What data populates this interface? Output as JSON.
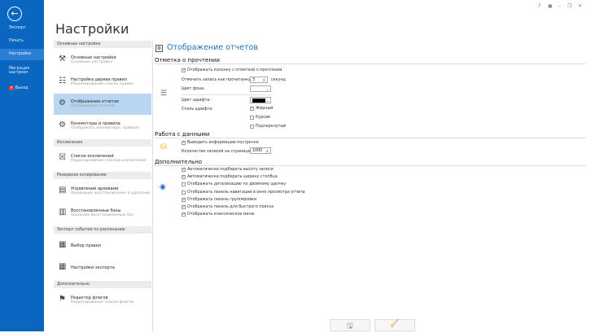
{
  "window": {
    "controls": [
      "?",
      "▣",
      "–",
      "❐",
      "✕"
    ]
  },
  "sidebar": {
    "items": [
      {
        "label": "Экспорт"
      },
      {
        "label": "Печать"
      },
      {
        "label": "Настройки"
      },
      {
        "label": "Миграция настроек"
      },
      {
        "label": "Выход"
      }
    ]
  },
  "page_title": "Настройки",
  "nav": {
    "groups": [
      {
        "header": "Основные настройки",
        "items": [
          {
            "title": "Основные настройки",
            "subtitle": "Основные настройки",
            "icon": "tools-icon"
          },
          {
            "title": "Настройка дерева правил",
            "subtitle": "Редактирование списка правил",
            "icon": "tree-icon"
          },
          {
            "title": "Отображение отчетов",
            "subtitle": "Отображение отчетов",
            "icon": "report-display-icon",
            "selected": true
          },
          {
            "title": "Коннекторы и правила",
            "subtitle": "Отображать коннекторы, правила",
            "icon": "gears-icon"
          }
        ]
      },
      {
        "header": "Исключения",
        "items": [
          {
            "title": "Список исключений",
            "subtitle": "Редактирование списков исключений",
            "icon": "exceptions-icon"
          }
        ]
      },
      {
        "header": "Резервное копирование",
        "items": [
          {
            "title": "Управление архивами",
            "subtitle": "Архивация, восстановление и удаление",
            "icon": "archive-icon"
          },
          {
            "title": "Восстановленные базы",
            "subtitle": "Удаление восстановленных баз",
            "icon": "restored-db-icon"
          }
        ]
      },
      {
        "header": "Экспорт событий по расписанию",
        "items": [
          {
            "title": "Выбор правил",
            "subtitle": "",
            "icon": "rules-icon"
          },
          {
            "title": "Настройки экспорта",
            "subtitle": "",
            "icon": "export-icon"
          }
        ]
      },
      {
        "header": "Дополнительно",
        "items": [
          {
            "title": "Редактор флагов",
            "subtitle": "Редактирование списка флагов",
            "icon": "flag-icon"
          }
        ]
      }
    ]
  },
  "content": {
    "title": "Отображение отчетов",
    "read": {
      "header": "Отметка о прочтении",
      "show_column": "Отображать колонку с отметкой о прочтении",
      "mark_label": "Отмечать запись как прочитанную:",
      "mark_value": "3",
      "mark_unit": "секунд",
      "bg_label": "Цвет фона:",
      "bg_color": "#ffffff",
      "font_label": "Цвет шрифта:",
      "font_color": "#000000",
      "style_label": "Стиль шрифта:",
      "styles": [
        {
          "label": "Жирный",
          "checked": true
        },
        {
          "label": "Курсив",
          "checked": false
        },
        {
          "label": "Подчеркнутый",
          "checked": false
        }
      ]
    },
    "data": {
      "header": "Работа с данными",
      "show_info": "Выводить информацию построчно",
      "count_label": "Количество записей на странице:",
      "count_value": "1000"
    },
    "extra": {
      "header": "Дополнительно",
      "options": [
        {
          "label": "Автоматически подбирать высоту записи",
          "checked": true
        },
        {
          "label": "Автоматически подбирать ширину столбца",
          "checked": true
        },
        {
          "label": "Отображать детализацию по двойному щелчку",
          "checked": false
        },
        {
          "label": "Отображать панель навигации в окне просмотра отчета",
          "checked": false
        },
        {
          "label": "Отображать панель группировки",
          "checked": true
        },
        {
          "label": "Отображать панель для быстрого поиска",
          "checked": true
        },
        {
          "label": "Отображать классическое меню",
          "checked": true
        }
      ]
    }
  },
  "footer": {
    "buttons": [
      {
        "icon": "save-icon"
      },
      {
        "icon": "clear-icon"
      }
    ]
  }
}
